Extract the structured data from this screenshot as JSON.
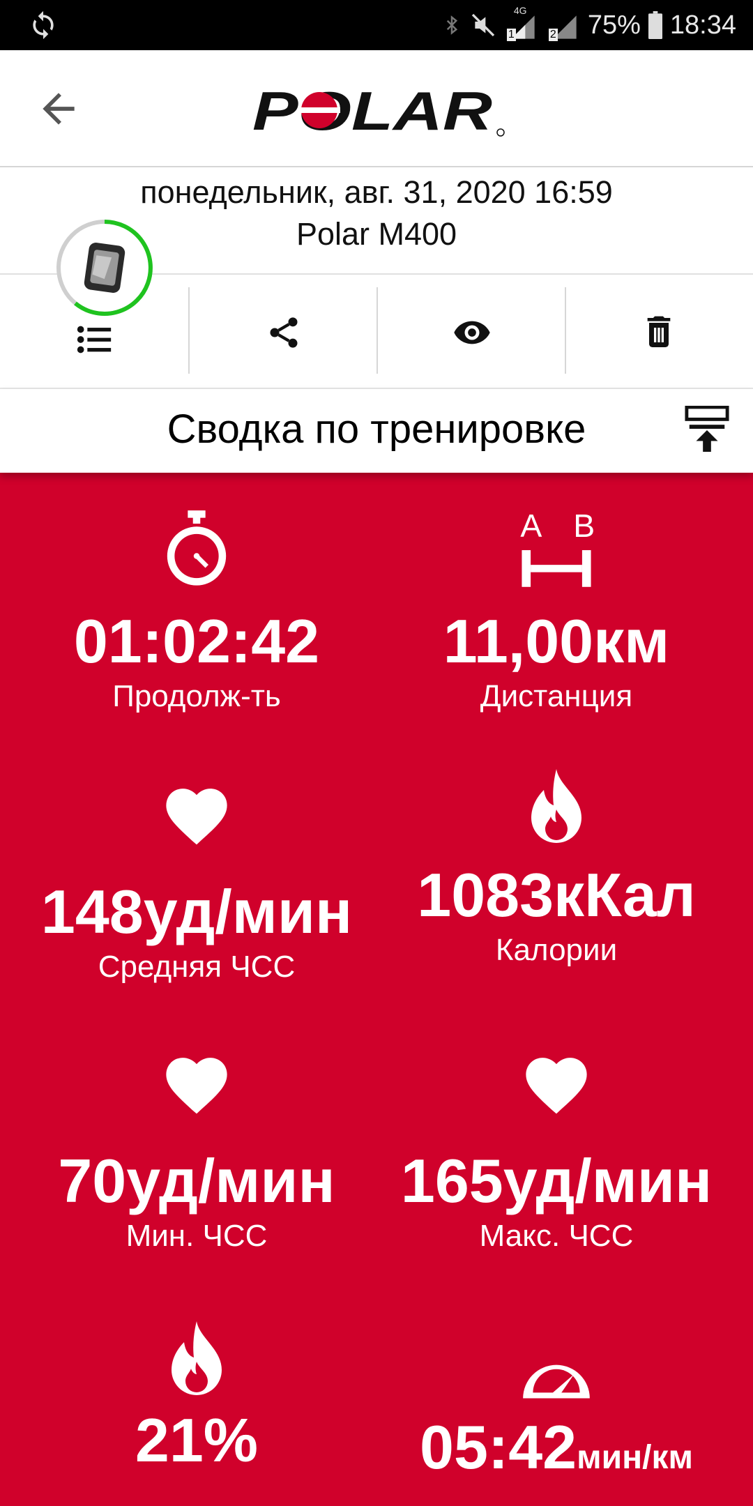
{
  "status_bar": {
    "network_label": "4G",
    "sim1": "1",
    "sim2": "2",
    "battery": "75%",
    "time": "18:34"
  },
  "app_bar": {
    "logo_text": "POLAR"
  },
  "session": {
    "date": "понедельник, авг. 31, 2020 16:59",
    "device": "Polar M400"
  },
  "section": {
    "title": "Сводка по тренировке"
  },
  "stats": {
    "duration": {
      "value": "01:02:42",
      "label": "Продолж-ть",
      "icon": "stopwatch-icon"
    },
    "distance": {
      "value": "11,00км",
      "label": "Дистанция",
      "icon": "distance-ab-icon",
      "icon_a": "A",
      "icon_b": "B"
    },
    "avg_hr": {
      "value": "148уд/мин",
      "label": "Средняя ЧСС",
      "icon": "heart-icon"
    },
    "calories": {
      "value": "1083кКал",
      "label": "Калории",
      "icon": "flame-icon"
    },
    "min_hr": {
      "value": "70уд/мин",
      "label": "Мин. ЧСС",
      "icon": "heart-icon"
    },
    "max_hr": {
      "value": "165уд/мин",
      "label": "Макс. ЧСС",
      "icon": "heart-icon"
    },
    "fat_burn": {
      "value": "21%",
      "icon": "flame-icon"
    },
    "pace": {
      "value": "05:42",
      "unit": "мин/км",
      "icon": "speedometer-icon"
    }
  },
  "colors": {
    "brand_red": "#d0012b",
    "progress_green": "#1fc31f"
  }
}
